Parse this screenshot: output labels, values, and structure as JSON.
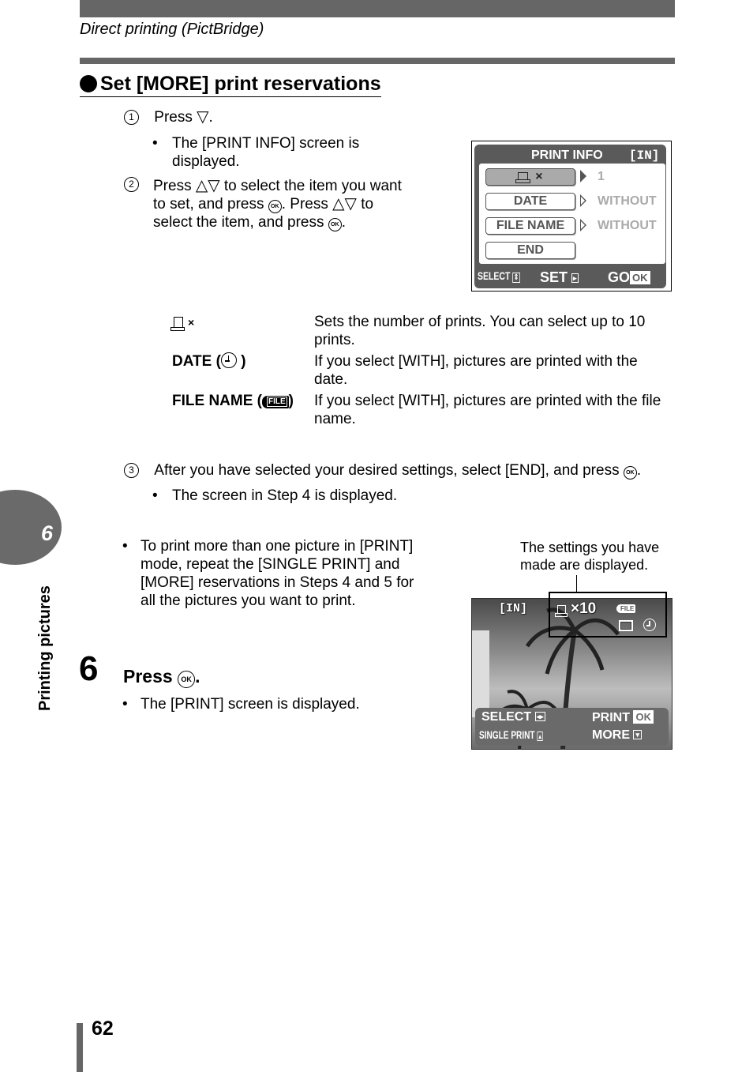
{
  "header": {
    "section_title": "Direct printing (PictBridge)"
  },
  "heading": {
    "bullet_icon": "filled-circle-icon",
    "title": "Set [MORE] print reservations"
  },
  "steps": [
    {
      "num": "1",
      "text_before": "Press",
      "icon": "down-arrow-icon",
      "text_after": ".",
      "bullet": "The [PRINT INFO] screen is displayed."
    },
    {
      "num": "2",
      "line1": "Press",
      "line1b": "to select the item you want",
      "line2": "to set, and press",
      "line2b": ". Press",
      "line2c": "to",
      "line3": "select the item, and press",
      "line3b": "."
    },
    {
      "num": "3",
      "text": "After you have selected your desired settings, select [END], and press",
      "text_after": ".",
      "bullet": "The screen in Step 4 is displayed."
    }
  ],
  "print_info_screen": {
    "title": "PRINT INFO",
    "memory": "[IN]",
    "items": [
      {
        "label": "×",
        "icon": "print-icon",
        "value": "1",
        "selected": true
      },
      {
        "label": "DATE",
        "value": "WITHOUT",
        "selected": false
      },
      {
        "label": "FILE NAME",
        "value": "WITHOUT",
        "selected": false
      },
      {
        "label": "END",
        "value": "",
        "selected": false
      }
    ],
    "footer": {
      "select": "SELECT",
      "set": "SET",
      "go": "GO",
      "ok": "OK"
    }
  },
  "definitions": [
    {
      "term": "×",
      "term_icon": "print-icon",
      "desc": "Sets the number of prints. You can select up to 10 prints."
    },
    {
      "term": "DATE (",
      "term_icon": "clock-icon",
      "term_end": ")",
      "desc": "If you select [WITH], pictures are printed with the date."
    },
    {
      "term": "FILE NAME (",
      "term_icon": "file-icon",
      "term_end": ")",
      "desc": "If you select [WITH], pictures are printed with the file name."
    }
  ],
  "note": {
    "text": "To print more than one picture in [PRINT] mode, repeat the [SINGLE PRINT] and [MORE] reservations in Steps 4 and 5 for all the pictures you want to print."
  },
  "callout": {
    "text": "The settings you have made are displayed."
  },
  "print_screen": {
    "memory": "[IN]",
    "count": "×10",
    "file_tag": "FILE",
    "select": "SELECT",
    "print": "PRINT",
    "ok": "OK",
    "single_print": "SINGLE PRINT",
    "more": "MORE"
  },
  "step6": {
    "num": "6",
    "title": "Press",
    "title_after": ".",
    "bullet": "The [PRINT] screen is displayed."
  },
  "side_tab": {
    "chapter": "6",
    "label": "Printing pictures"
  },
  "page_number": "62",
  "ok_glyph": "OK"
}
